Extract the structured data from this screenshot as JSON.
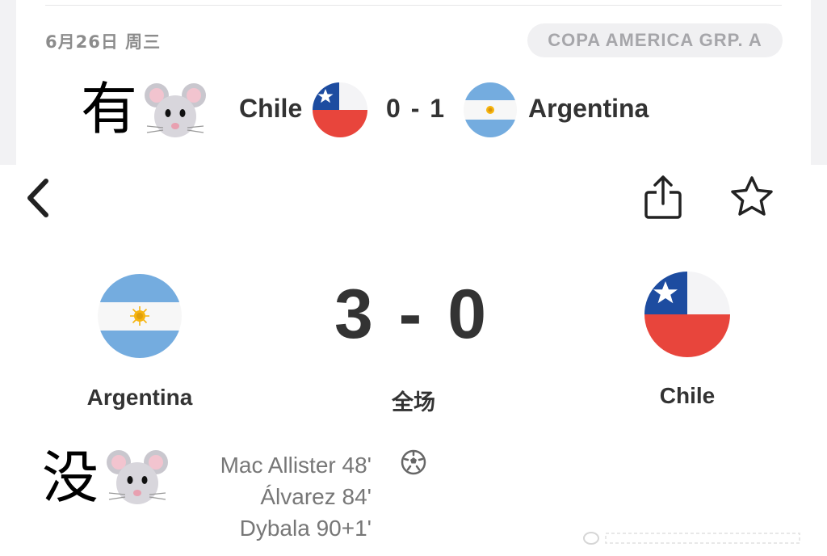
{
  "top_match": {
    "date": "6月26日 周三",
    "competition": "COPA AMERICA GRP. A",
    "home_team": "Chile",
    "score": "0 - 1",
    "away_team": "Argentina"
  },
  "captions": {
    "top": "有",
    "bottom": "没"
  },
  "header": {
    "back_icon": "chevron-left-icon",
    "share_icon": "share-icon",
    "favorite_icon": "star-icon"
  },
  "match": {
    "home_team": "Argentina",
    "away_team": "Chile",
    "score": "3 - 0",
    "status": "全场",
    "goal_icon": "soccer-ball-icon",
    "scorers": [
      "Mac Allister 48'",
      "Álvarez 84'",
      "Dybala 90+1'"
    ]
  },
  "colors": {
    "argentina_sky_blue": "#74ACDF",
    "argentina_sun": "#F6B40E",
    "chile_red": "#E8453C",
    "chile_blue": "#1D4CA0",
    "text_dark": "#333333",
    "text_grey": "#777777"
  }
}
